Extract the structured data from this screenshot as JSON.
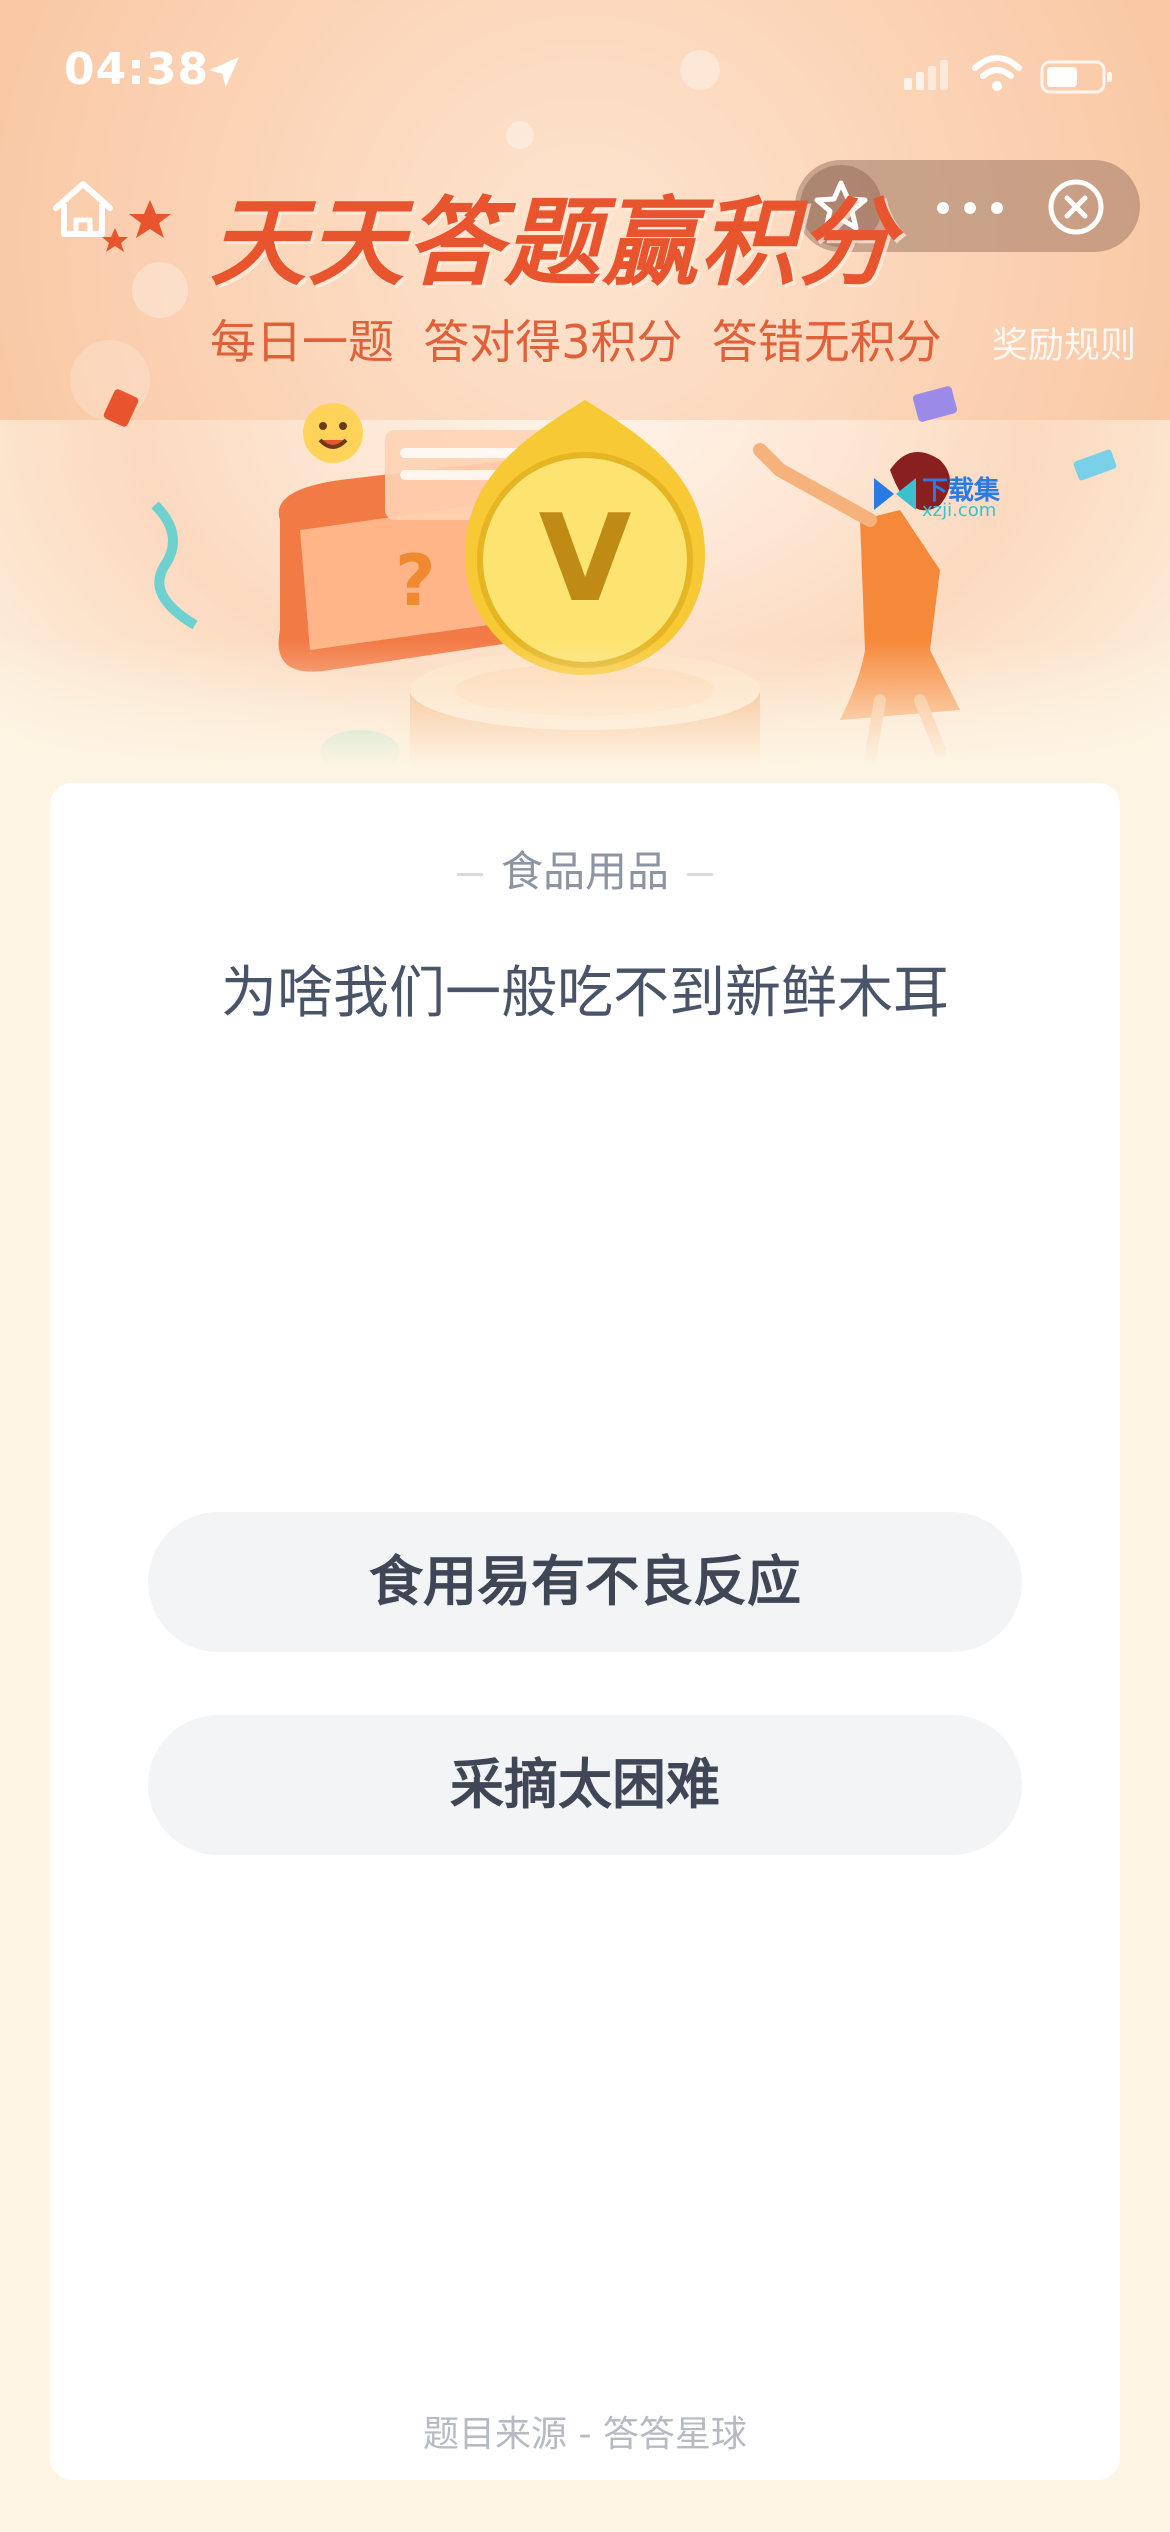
{
  "status_bar": {
    "time": "04:38",
    "icons": [
      "location-arrow-icon",
      "signal-icon",
      "wifi-icon",
      "battery-icon"
    ]
  },
  "nav": {
    "icons": [
      "home-icon",
      "star-icon",
      "more-icon",
      "close-icon"
    ]
  },
  "banner": {
    "title": "天天答题赢积分",
    "subtitle": "每日一题  答对得3积分  答错无积分",
    "rules_link": "奖励规则",
    "coin_letter": "V",
    "watermark_text": "下载集",
    "watermark_url": "xzji.com"
  },
  "quiz": {
    "category": "食品用品",
    "question": "为啥我们一般吃不到新鲜木耳",
    "options": [
      {
        "label": "食用易有不良反应"
      },
      {
        "label": "采摘太困难"
      }
    ],
    "source": "题目来源 - 答答星球"
  },
  "colors": {
    "title": "#e8542d",
    "banner_bg": "#f7bf97",
    "page_bg": "#fdf4e3",
    "option_bg": "#f3f4f6",
    "question_text": "#4a5468"
  }
}
